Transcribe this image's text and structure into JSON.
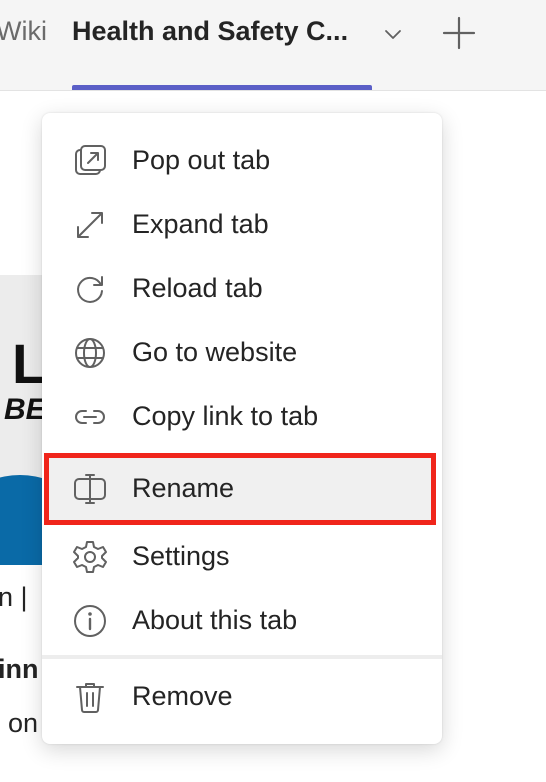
{
  "tabs": {
    "previous_label": "Wiki",
    "active_label": "Health and Safety C...",
    "accent_color": "#5b5fc7"
  },
  "background": {
    "banner_letter": "L",
    "banner_sub": "BE",
    "line1": "n |",
    "line2": "inn",
    "line3": "on"
  },
  "menu": {
    "items": [
      {
        "label": "Pop out tab",
        "icon": "pop-out-icon"
      },
      {
        "label": "Expand tab",
        "icon": "expand-icon"
      },
      {
        "label": "Reload tab",
        "icon": "reload-icon"
      },
      {
        "label": "Go to website",
        "icon": "globe-icon"
      },
      {
        "label": "Copy link to tab",
        "icon": "link-icon"
      },
      {
        "label": "Rename",
        "icon": "rename-icon"
      },
      {
        "label": "Settings",
        "icon": "gear-icon"
      },
      {
        "label": "About this tab",
        "icon": "info-icon"
      },
      {
        "label": "Remove",
        "icon": "trash-icon"
      }
    ],
    "highlighted_item": "Rename",
    "highlight_color": "#f0251b"
  }
}
